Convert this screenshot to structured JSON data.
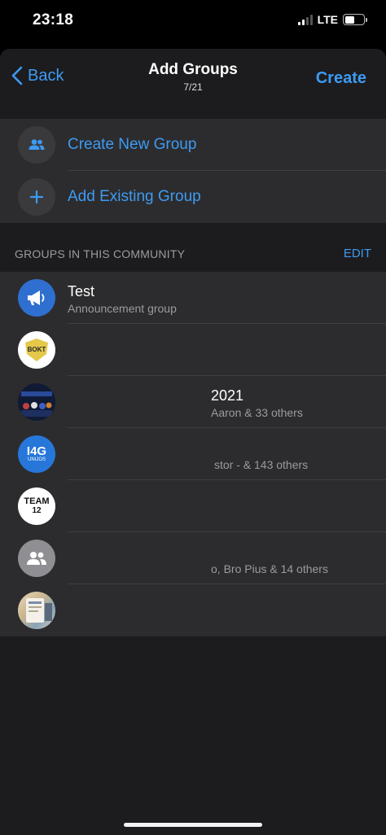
{
  "status": {
    "time": "23:18",
    "network": "LTE"
  },
  "nav": {
    "back_label": "Back",
    "title": "Add Groups",
    "subtitle": "7/21",
    "create_label": "Create"
  },
  "actions": [
    {
      "label": "Create New Group",
      "icon": "people-icon"
    },
    {
      "label": "Add Existing Group",
      "icon": "plus-icon"
    }
  ],
  "section": {
    "title": "GROUPS IN THIS COMMUNITY",
    "edit_label": "EDIT"
  },
  "groups": [
    {
      "name": "Test",
      "subtitle": "Announcement group",
      "avatar": "megaphone-icon"
    },
    {
      "name": "",
      "subtitle": "",
      "avatar_text": "BOKT"
    },
    {
      "name": "2021",
      "subtitle": "Aaron & 33 others"
    },
    {
      "name": "",
      "subtitle": "stor - & 143 others",
      "avatar_text": "I4G",
      "avatar_subtext": "UNIJOS"
    },
    {
      "name": "",
      "subtitle": "",
      "avatar_text": "TEAM",
      "avatar_subtext": "12"
    },
    {
      "name": "",
      "subtitle": "o, Bro Pius & 14 others",
      "avatar": "people-icon"
    },
    {
      "name": "",
      "subtitle": ""
    }
  ],
  "colors": {
    "accent": "#3d9bf2",
    "background": "#1c1c1e",
    "cell": "#2c2c2e",
    "secondary_text": "#9b9b9f"
  }
}
